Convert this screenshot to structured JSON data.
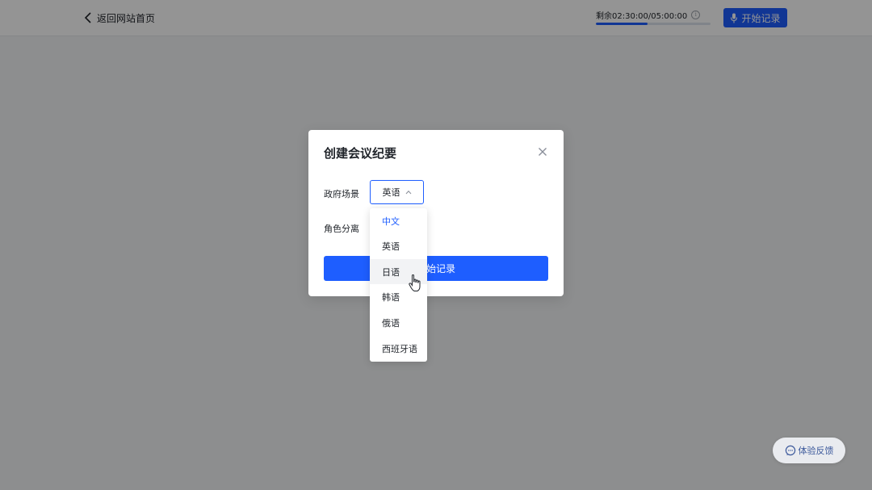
{
  "header": {
    "back_label": "返回网站首页",
    "timer_text": "剩余02:30:00/05:00:00",
    "timer_progress": 0.45,
    "start_label": "开始记录"
  },
  "modal": {
    "title": "创建会议纪要",
    "scene_label": "政府场景",
    "role_label": "角色分离",
    "selected_language": "英语",
    "start_label": "开始记录"
  },
  "dropdown": {
    "options": [
      "中文",
      "英语",
      "日语",
      "韩语",
      "俄语",
      "西班牙语"
    ],
    "highlighted": "中文",
    "hovered": "日语"
  },
  "feedback": {
    "label": "体验反馈"
  },
  "colors": {
    "accent": "#1e5eff",
    "overlay": "rgba(0,0,0,0.42)"
  }
}
